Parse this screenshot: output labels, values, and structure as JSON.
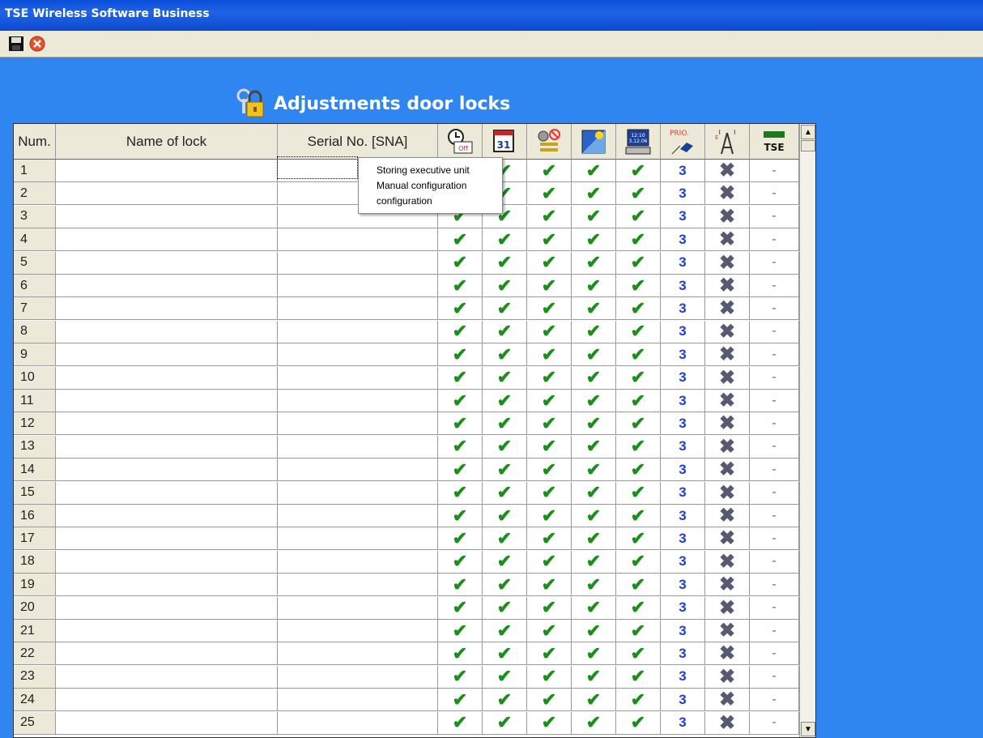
{
  "window": {
    "title": "TSE Wireless Software Business"
  },
  "toolbar": {
    "save_icon": "floppy-disk-icon",
    "close_icon": "red-close-icon"
  },
  "heading": {
    "text": "Adjustments door locks",
    "icon": "padlock-keys-icon"
  },
  "table": {
    "headers": {
      "num": "Num.",
      "name": "Name of lock",
      "serial": "Serial No. [SNA]"
    },
    "icon_columns": [
      "clock-off-icon",
      "calendar-31-icon",
      "keys-blocked-icon",
      "sun-window-icon",
      "date-time-display-icon",
      "prio-tag-icon",
      "radio-tower-icon",
      "tse-badge-icon"
    ],
    "icon_texts": {
      "prio": "PRIO.",
      "tse": "TSE",
      "date": "12:10 3.12.06",
      "cal": "31"
    },
    "rows": [
      {
        "num": "1",
        "prio": "3",
        "tse": "-"
      },
      {
        "num": "2",
        "prio": "3",
        "tse": "-"
      },
      {
        "num": "3",
        "prio": "3",
        "tse": "-"
      },
      {
        "num": "4",
        "prio": "3",
        "tse": "-"
      },
      {
        "num": "5",
        "prio": "3",
        "tse": "-"
      },
      {
        "num": "6",
        "prio": "3",
        "tse": "-"
      },
      {
        "num": "7",
        "prio": "3",
        "tse": "-"
      },
      {
        "num": "8",
        "prio": "3",
        "tse": "-"
      },
      {
        "num": "9",
        "prio": "3",
        "tse": "-"
      },
      {
        "num": "10",
        "prio": "3",
        "tse": "-"
      },
      {
        "num": "11",
        "prio": "3",
        "tse": "-"
      },
      {
        "num": "12",
        "prio": "3",
        "tse": "-"
      },
      {
        "num": "13",
        "prio": "3",
        "tse": "-"
      },
      {
        "num": "14",
        "prio": "3",
        "tse": "-"
      },
      {
        "num": "15",
        "prio": "3",
        "tse": "-"
      },
      {
        "num": "16",
        "prio": "3",
        "tse": "-"
      },
      {
        "num": "17",
        "prio": "3",
        "tse": "-"
      },
      {
        "num": "18",
        "prio": "3",
        "tse": "-"
      },
      {
        "num": "19",
        "prio": "3",
        "tse": "-"
      },
      {
        "num": "20",
        "prio": "3",
        "tse": "-"
      },
      {
        "num": "21",
        "prio": "3",
        "tse": "-"
      },
      {
        "num": "22",
        "prio": "3",
        "tse": "-"
      },
      {
        "num": "23",
        "prio": "3",
        "tse": "-"
      },
      {
        "num": "24",
        "prio": "3",
        "tse": "-"
      },
      {
        "num": "25",
        "prio": "3",
        "tse": "-"
      }
    ],
    "check_glyph": "✔",
    "x_glyph": "✖"
  },
  "context_menu": {
    "items": [
      "Storing executive unit",
      "Manual configuration",
      "configuration"
    ]
  },
  "colors": {
    "background": "#2f86f0",
    "check": "#1a8f1a",
    "prio": "#1f3fd8"
  }
}
